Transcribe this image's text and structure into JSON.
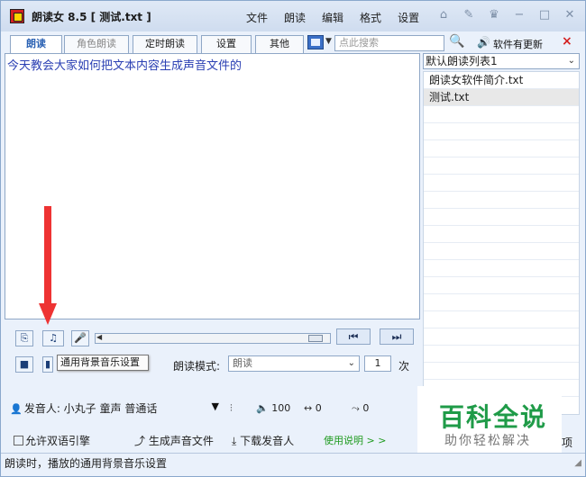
{
  "window": {
    "title": "朗读女 8.5 [ 测试.txt ]"
  },
  "menu": [
    "文件",
    "朗读",
    "编辑",
    "格式",
    "设置"
  ],
  "title_controls": [
    "home-icon",
    "pin-icon",
    "skin-icon",
    "minimize-icon",
    "maximize-icon",
    "close-icon"
  ],
  "tabs": [
    "朗读",
    "角色朗读",
    "定时朗读",
    "设置",
    "其他"
  ],
  "search": {
    "placeholder": "点此搜索",
    "button": "🔍"
  },
  "update": {
    "icon": "🔊",
    "label": "软件有更新",
    "close": "×"
  },
  "editor": {
    "text": "今天教会大家如何把文本内容生成声音文件的"
  },
  "playlist": {
    "selected": "默认朗读列表1",
    "items": [
      "朗读女软件简介.txt",
      "测试.txt"
    ]
  },
  "controls": {
    "icons": [
      "book-icon",
      "music-icon",
      "mic-icon"
    ],
    "prev": "⏮",
    "next": "⏭",
    "stop": "■",
    "pause": "▮"
  },
  "tooltip": "通用背景音乐设置",
  "mode": {
    "label": "朗读模式:",
    "value": "朗读",
    "count": "1",
    "unit": "次"
  },
  "voice": {
    "label": "发音人: 小丸子 童声 普通话",
    "volume": "100",
    "speed": "0",
    "pitch": "0"
  },
  "options": {
    "bilingual": "允许双语引擎",
    "generate": "生成声音文件",
    "download": "下载发音人",
    "help": "使用说明 > >",
    "extra": "项"
  },
  "watermark": {
    "title": "百科全说",
    "subtitle": "助你轻松解决"
  },
  "status": "朗读时，播放的通用背景音乐设置"
}
